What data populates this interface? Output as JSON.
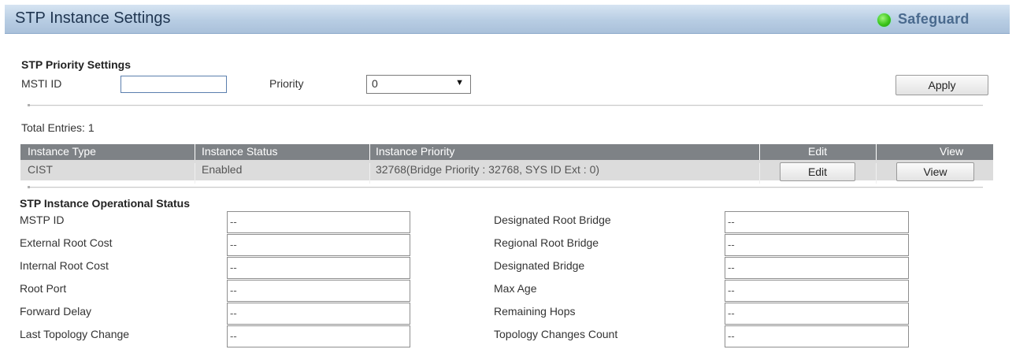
{
  "header": {
    "title": "STP Instance Settings",
    "safeguard_label": "Safeguard"
  },
  "priority_settings": {
    "heading": "STP Priority Settings",
    "msti_label": "MSTI ID",
    "msti_value": "",
    "priority_label": "Priority",
    "priority_value": "0",
    "apply_label": "Apply"
  },
  "table": {
    "total_entries": "Total Entries: 1",
    "headers": [
      "Instance Type",
      "Instance Status",
      "Instance Priority",
      "Edit",
      "View"
    ],
    "rows": [
      {
        "type": "CIST",
        "status": "Enabled",
        "priority": "32768(Bridge Priority : 32768, SYS ID Ext : 0)",
        "edit_label": "Edit",
        "view_label": "View"
      }
    ]
  },
  "operational_status": {
    "heading": "STP Instance Operational Status",
    "left": [
      {
        "label": "MSTP ID",
        "value": "--"
      },
      {
        "label": "External Root Cost",
        "value": "--"
      },
      {
        "label": "Internal Root Cost",
        "value": "--"
      },
      {
        "label": "Root Port",
        "value": "--"
      },
      {
        "label": "Forward Delay",
        "value": "--"
      },
      {
        "label": "Last Topology Change",
        "value": "--"
      }
    ],
    "right": [
      {
        "label": "Designated Root Bridge",
        "value": "--"
      },
      {
        "label": "Regional Root Bridge",
        "value": "--"
      },
      {
        "label": "Designated Bridge",
        "value": "--"
      },
      {
        "label": "Max Age",
        "value": "--"
      },
      {
        "label": "Remaining Hops",
        "value": "--"
      },
      {
        "label": "Topology Changes Count",
        "value": "--"
      }
    ]
  },
  "colors": {
    "title_bar": "#b8cde3",
    "table_header": "#7e8286",
    "table_row": "#dcdcdc",
    "safeguard_indicator": "#3cc51a"
  }
}
